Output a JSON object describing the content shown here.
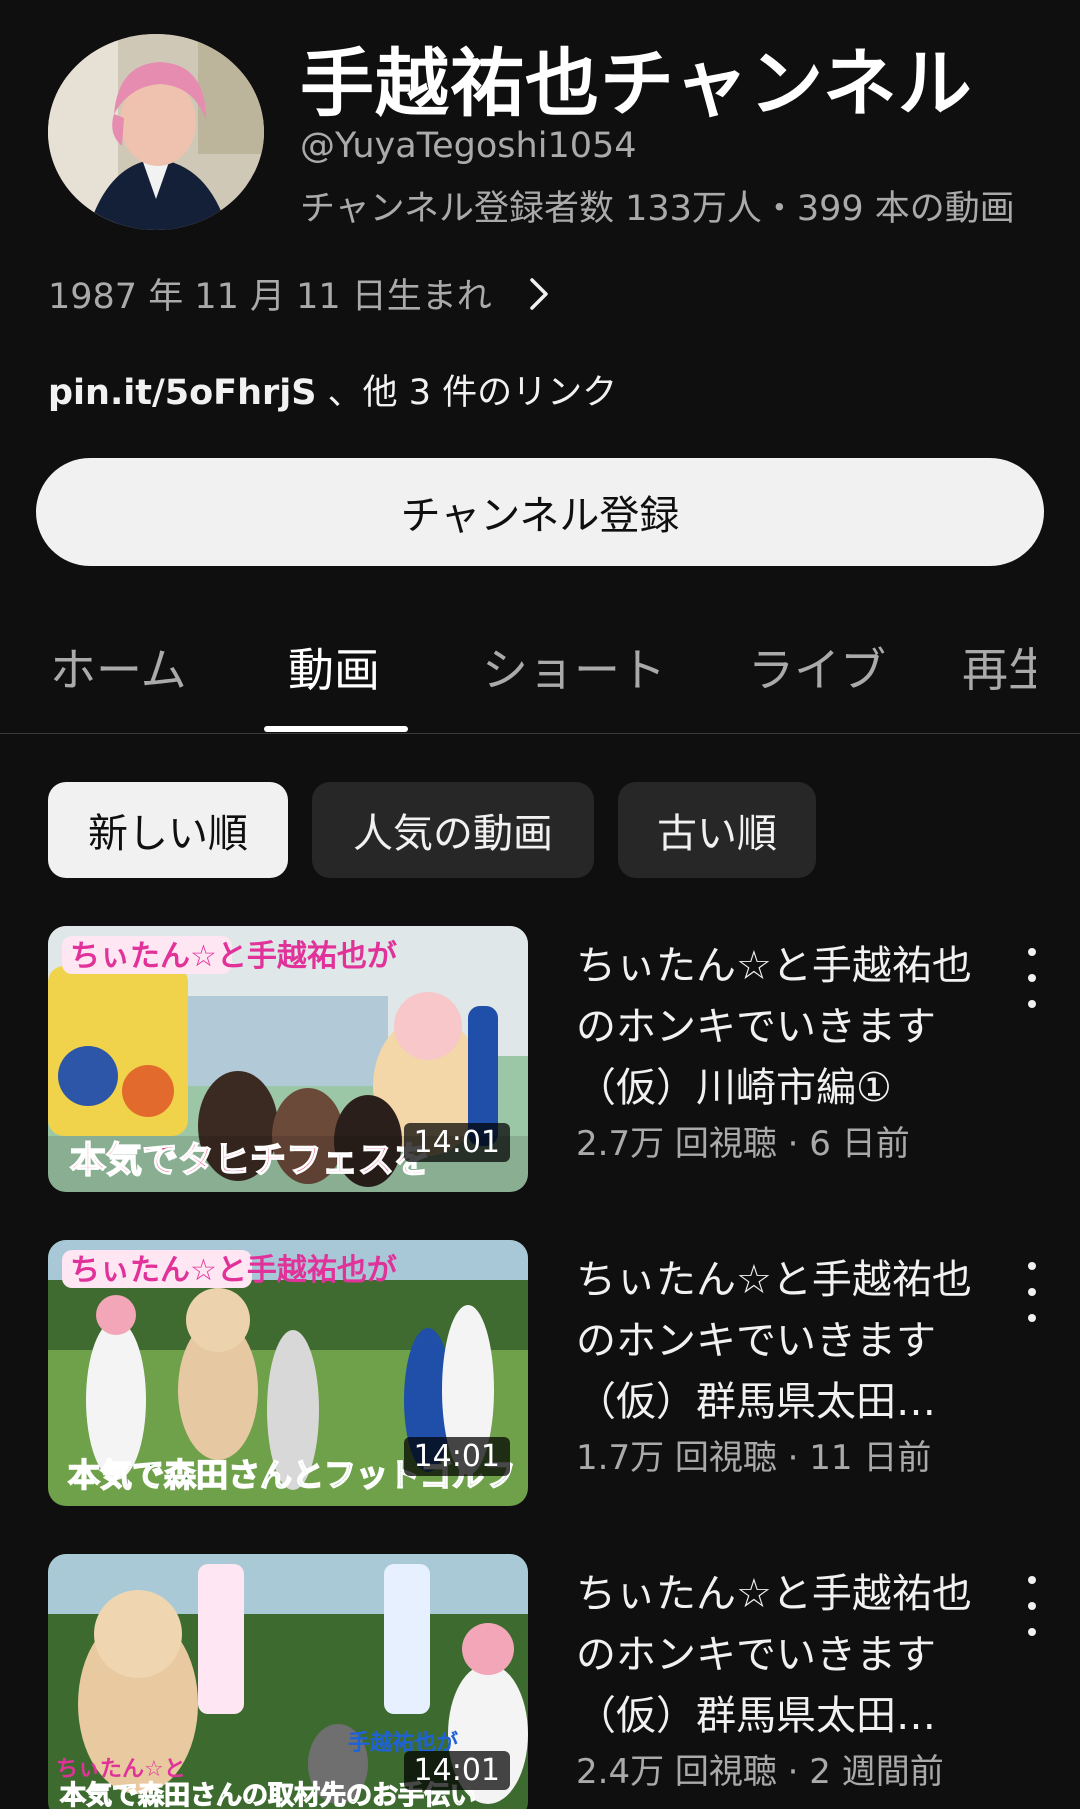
{
  "channel": {
    "name": "手越祐也チャンネル",
    "handle": "@YuyaTegoshi1054",
    "stats": "チャンネル登録者数 133万人・399 本の動画",
    "about": "1987 年 11 月 11 日生まれ",
    "links_main": "pin.it/5oFhrjS",
    "links_more": " 、他 3 件のリンク",
    "subscribe_label": "チャンネル登録"
  },
  "tabs": [
    {
      "label": "ホーム",
      "active": false
    },
    {
      "label": "動画",
      "active": true
    },
    {
      "label": "ショート",
      "active": false
    },
    {
      "label": "ライブ",
      "active": false
    },
    {
      "label": "再生",
      "active": false
    }
  ],
  "chips": [
    {
      "label": "新しい順",
      "selected": true
    },
    {
      "label": "人気の動画",
      "selected": false
    },
    {
      "label": "古い順",
      "selected": false
    }
  ],
  "videos": [
    {
      "title": "ちぃたん☆と手越祐也のホンキでいきます（仮）川崎市編①",
      "meta": "2.7万 回視聴 · 6 日前",
      "duration": "14:01",
      "thumb_text": [
        "ちぃたん☆と手越祐也が",
        "本気でタヒチフェスを"
      ]
    },
    {
      "title": "ちぃたん☆と手越祐也のホンキでいきます（仮）群馬県太田…",
      "meta": "1.7万 回視聴 · 11 日前",
      "duration": "14:01",
      "thumb_text": [
        "ちぃたん☆と手越祐也が",
        "本気で森田さんとフットゴルフ"
      ]
    },
    {
      "title": "ちぃたん☆と手越祐也のホンキでいきます（仮）群馬県太田…",
      "meta": "2.4万 回視聴 · 2 週間前",
      "duration": "14:01",
      "thumb_text": [
        "ちぃたん☆と",
        "手越祐也が",
        "本気で森田さんの取材先のお手伝い"
      ]
    }
  ],
  "colors": {
    "background": "#0f0f0f",
    "chip_selected": "#f1f1f1",
    "chip_unselected": "#272727",
    "secondary_text": "#aaaaaa"
  }
}
